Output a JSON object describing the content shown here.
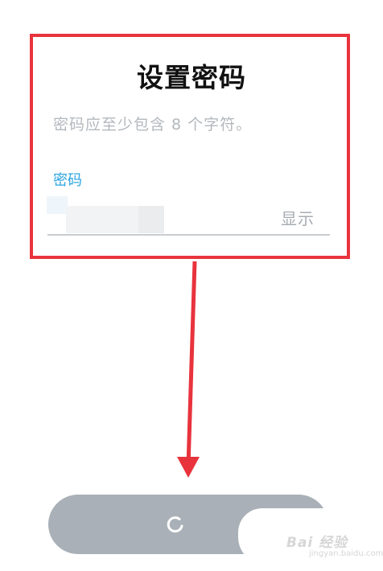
{
  "dialog": {
    "title": "设置密码",
    "subtitle": "密码应至少包含 8 个字符。",
    "field_label": "密码",
    "show_label": "显示"
  },
  "annotation": {
    "color": "#e8333d"
  },
  "next_button": {
    "color": "#a9b0b7",
    "icon": "loading-spinner-icon"
  },
  "watermark": {
    "text": "Bai 经验",
    "sub": "jingyan.baidu.com"
  }
}
